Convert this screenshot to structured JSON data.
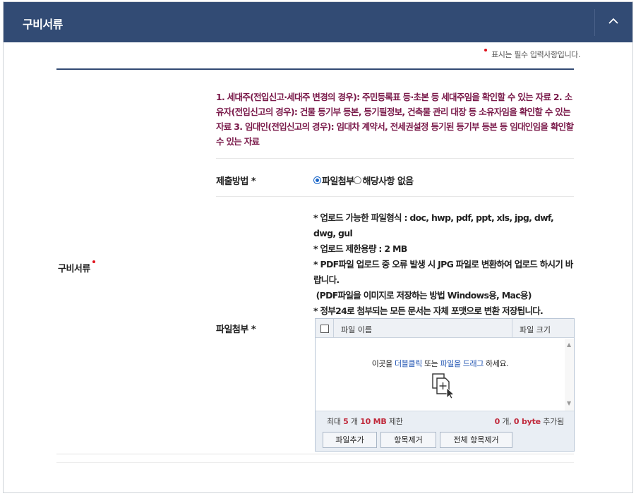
{
  "header": {
    "title": "구비서류"
  },
  "required_note": "표시는 필수 입력사항입니다.",
  "row_label": "구비서류",
  "notice": "1. 세대주(전입신고·세대주 변경의 경우): 주민등록표 등·초본 등 세대주임을 확인할 수 있는 자료 2. 소유자(전입신고의 경우): 건물 등기부 등본, 등기필정보, 건축물 관리 대장 등 소유자임을 확인할 수 있는 자료 3. 임대인(전입신고의 경우): 임대차 계약서, 전세권설정 등기된 등기부 등본 등 임대인임을 확인할 수 있는 자료",
  "submission_method": {
    "label": "제출방법 *",
    "options": [
      {
        "label": "파일첨부",
        "checked": true
      },
      {
        "label": "해당사항 없음",
        "checked": false
      }
    ]
  },
  "attachment": {
    "label": "파일첨부 *",
    "info": [
      "* 업로드 가능한 파일형식 : doc, hwp, pdf, ppt, xls, jpg, dwf, dwg, gul",
      "* 업로드 제한용량 : 2 MB",
      "* PDF파일 업로드 중 오류 발생 시 JPG 파일로 변환하여 업로드 하시기 바랍니다.",
      " (PDF파일을 이미지로 저장하는 방법 Windows용, Mac용)",
      "* 정부24로 첨부되는 모든 문서는 자체 포맷으로 변환 저장됩니다."
    ]
  },
  "uploader": {
    "col_name": "파일 이름",
    "col_size": "파일 크기",
    "drop_prefix": "이곳을 ",
    "drop_link1": "더블클릭",
    "drop_middle": " 또는 ",
    "drop_link2": "파일을 드래그",
    "drop_suffix": " 하세요.",
    "limit_prefix": "최대 ",
    "limit_count": "5",
    "limit_count_unit": " 개 ",
    "limit_size": "10 MB",
    "limit_suffix": " 제한",
    "added_count": "0",
    "added_count_unit": " 개, ",
    "added_size": "0 byte",
    "added_suffix": " 추가됨",
    "buttons": {
      "add": "파일추가",
      "remove": "항목제거",
      "remove_all": "전체 항목제거"
    }
  },
  "colors": {
    "header_bg": "#324b74",
    "notice_text": "#7a1a4a",
    "required_dot": "#e0121b",
    "radio_checked": "#1a66c8"
  },
  "icons": {
    "collapse": "chevron-up-icon",
    "drop": "add-document-cursor-icon"
  }
}
